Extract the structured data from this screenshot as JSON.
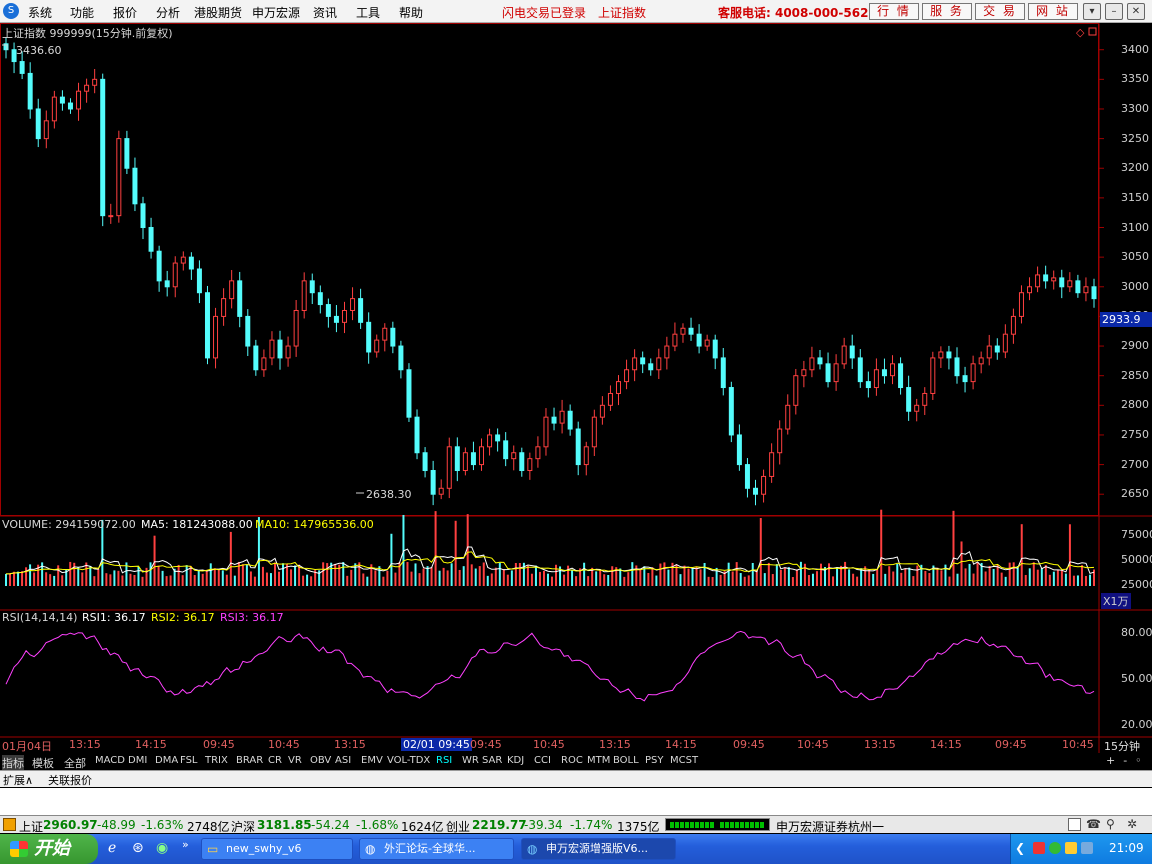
{
  "menubar": {
    "items": [
      "系统",
      "功能",
      "报价",
      "分析",
      "港股期货",
      "申万宏源",
      "资讯",
      "工具",
      "帮助"
    ],
    "status1": "闪电交易已登录",
    "status2": "上证指数",
    "hotline": "客服电话: 4008-000-562",
    "buttons": [
      "行 情",
      "服 务",
      "交 易",
      "网 站"
    ]
  },
  "chart": {
    "title": "上证指数 999999(15分钟.前复权)",
    "high_label": "3436.60",
    "low_label": "2638.30",
    "last_price": "2933.9",
    "price_axis": [
      "3400",
      "3350",
      "3300",
      "3250",
      "3200",
      "3150",
      "3100",
      "3050",
      "3000",
      "2950",
      "2900",
      "2850",
      "2800",
      "2750",
      "2700",
      "2650"
    ],
    "volume_label": "VOLUME: 294159072.00",
    "ma5_label": "MA5: 181243088.00",
    "ma10_label": "MA10: 147965536.00",
    "volume_axis": [
      "75000",
      "50000",
      "25000"
    ],
    "volume_unit": "X1万",
    "rsi_label": "RSI(14,14,14)",
    "rsi1_label": "RSI1: 36.17",
    "rsi2_label": "RSI2: 36.17",
    "rsi3_label": "RSI3: 36.17",
    "rsi_axis": [
      "80.00",
      "50.00",
      "20.00"
    ],
    "time_axis": [
      "01月04日",
      "13:15",
      "14:15",
      "09:45",
      "10:45",
      "13:15",
      "02/01 09:45",
      "09:45",
      "10:45",
      "13:15",
      "14:15",
      "09:45",
      "10:45",
      "13:15",
      "14:15",
      "09:45",
      "10:45"
    ],
    "period_label": "15分钟",
    "colors": {
      "up": "#ff4040",
      "down": "#54fcfc",
      "ma5": "#ffffff",
      "ma10": "#ffff00",
      "rsi": "#ff40ff"
    }
  },
  "chart_data": {
    "type": "candlestick",
    "title": "上证指数 999999(15分钟.前复权)",
    "ylim": [
      2620,
      3440
    ],
    "close": [
      3400,
      3380,
      3360,
      3300,
      3250,
      3280,
      3320,
      3310,
      3300,
      3330,
      3340,
      3350,
      3120,
      3120,
      3250,
      3200,
      3140,
      3100,
      3060,
      3010,
      3000,
      3040,
      3050,
      3030,
      2990,
      2880,
      2950,
      2980,
      3010,
      2950,
      2900,
      2860,
      2880,
      2910,
      2880,
      2900,
      2960,
      3010,
      2990,
      2970,
      2950,
      2940,
      2960,
      2980,
      2940,
      2890,
      2910,
      2930,
      2900,
      2860,
      2780,
      2720,
      2690,
      2650,
      2660,
      2730,
      2690,
      2720,
      2700,
      2730,
      2750,
      2740,
      2710,
      2720,
      2690,
      2710,
      2730,
      2780,
      2770,
      2790,
      2760,
      2700,
      2730,
      2780,
      2800,
      2820,
      2840,
      2860,
      2880,
      2870,
      2860,
      2880,
      2900,
      2920,
      2930,
      2920,
      2900,
      2910,
      2880,
      2830,
      2750,
      2700,
      2660,
      2650,
      2680,
      2720,
      2760,
      2800,
      2850,
      2860,
      2880,
      2870,
      2840,
      2870,
      2900,
      2880,
      2840,
      2830,
      2860,
      2850,
      2870,
      2830,
      2790,
      2800,
      2820,
      2880,
      2890,
      2880,
      2850,
      2840,
      2870,
      2880,
      2900,
      2890,
      2920,
      2950,
      2990,
      3000,
      3020,
      3010,
      3015,
      3000,
      3010,
      2990,
      3000,
      2980
    ],
    "volume_ylim": [
      0,
      80000
    ],
    "rsi_ylim": [
      10,
      90
    ]
  },
  "tabs": [
    "指标",
    "模板",
    "全部",
    "MACD",
    "DMI",
    "DMA",
    "FSL",
    "TRIX",
    "BRAR",
    "CR",
    "VR",
    "OBV",
    "ASI",
    "EMV",
    "VOL-TDX",
    "RSI",
    "WR",
    "SAR",
    "KDJ",
    "CCI",
    "ROC",
    "MTM",
    "BOLL",
    "PSY",
    "MCST"
  ],
  "subtabs": [
    "扩展∧",
    "关联报价"
  ],
  "status": {
    "sh_name": "上证",
    "sh_price": "2960.97",
    "sh_chg": "-48.99",
    "sh_pct": "-1.63%",
    "sh_amt": "2748亿",
    "hs_name": "沪深",
    "hs_price": "3181.85",
    "hs_chg": "-54.24",
    "hs_pct": "-1.68%",
    "hs_amt": "1624亿",
    "cy_name": "创业",
    "cy_price": "2219.77",
    "cy_chg": "-39.34",
    "cy_pct": "-1.74%",
    "cy_amt": "1375亿",
    "broker": "申万宏源证券杭州一"
  },
  "taskbar": {
    "start": "开始",
    "tasks": [
      "new_swhy_v6",
      "外汇论坛-全球华...",
      "申万宏源增强版V6..."
    ],
    "clock": "21:09"
  }
}
